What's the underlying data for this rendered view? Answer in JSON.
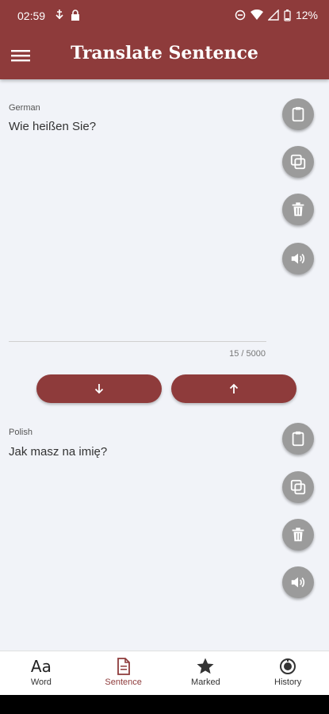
{
  "status_bar": {
    "time": "02:59",
    "battery": "12%"
  },
  "header": {
    "title": "Translate Sentence"
  },
  "source": {
    "language": "German",
    "text": "Wie heißen Sie?",
    "counter": "15 / 5000"
  },
  "target": {
    "language": "Polish",
    "text": "Jak masz na imię?"
  },
  "icons": {
    "fab_column": [
      "clipboard-icon",
      "copy-icon",
      "trash-icon",
      "speaker-icon"
    ],
    "swap": [
      "arrow-down-icon",
      "arrow-up-icon"
    ]
  },
  "bottom_nav": {
    "items": [
      {
        "label": "Word",
        "icon": "Aa"
      },
      {
        "label": "Sentence",
        "icon": "document-icon"
      },
      {
        "label": "Marked",
        "icon": "star-icon"
      },
      {
        "label": "History",
        "icon": "history-icon"
      }
    ],
    "active": "Sentence"
  },
  "colors": {
    "primary": "#8e3b3b",
    "fab": "#9b9b9b",
    "background": "#f1f3f8"
  }
}
